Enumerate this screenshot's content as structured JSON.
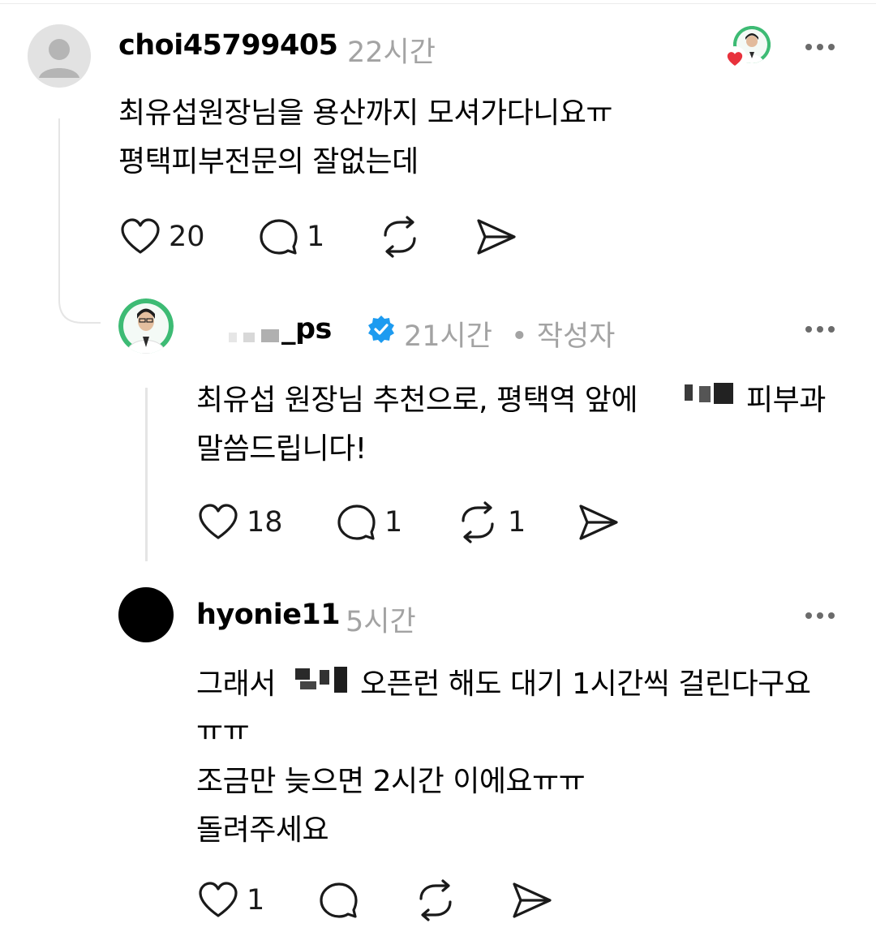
{
  "comments": [
    {
      "username": "choi45799405",
      "time": "22시간",
      "lines": [
        "최유섭원장님을 용산까지 모셔가다니요ㅠ",
        "평택피부전문의 잘없는데"
      ],
      "likes": "20",
      "replies": "1",
      "reposts": ""
    },
    {
      "username_visible": "_ps",
      "time": "21시간",
      "author_tag": "• 작성자",
      "line1_a": "최유섭 원장님 추천으로, 평택역 앞에",
      "line1_b": "피부과",
      "line2": "말씀드립니다!",
      "likes": "18",
      "replies": "1",
      "reposts": "1"
    },
    {
      "username": "hyonie11",
      "time": "5시간",
      "line1_a": "그래서",
      "line1_b": "오픈런 해도 대기 1시간씩 걸린다구요",
      "line2": "ㅠㅠ",
      "line3": "조금만 늦으면 2시간 이에요ㅠㅠ",
      "line4": "돌려주세요",
      "likes": "1",
      "replies": "",
      "reposts": ""
    }
  ],
  "colors": {
    "meta": "#a3a3a3",
    "verified": "#1d9bf0",
    "heart_badge": "#e8323c",
    "avatar_green": "#34b36b"
  },
  "icons": [
    "heart-icon",
    "comment-icon",
    "repost-icon",
    "send-icon",
    "more-icon",
    "verified-badge-icon",
    "default-avatar-icon"
  ]
}
